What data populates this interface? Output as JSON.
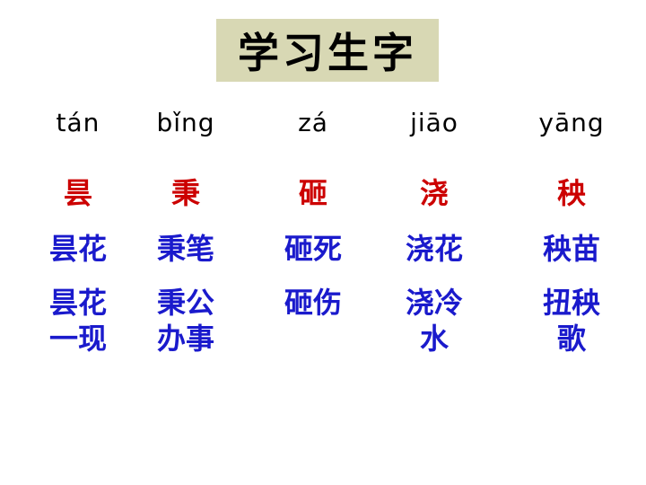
{
  "title": "学习生字",
  "colors": {
    "title_bg": "#d8d8b4",
    "char_color": "#cc0000",
    "word_color": "#1a1acc",
    "pinyin_color": "#000000"
  },
  "columns": [
    {
      "pinyin": "tán",
      "char": "昙",
      "word": "昙花",
      "phrase": "昙花\n一现"
    },
    {
      "pinyin": "bǐng",
      "char": "秉",
      "word": "秉笔",
      "phrase": "秉公\n办事"
    },
    {
      "pinyin": "zá",
      "char": "砸",
      "word": "砸死",
      "phrase": "砸伤"
    },
    {
      "pinyin": "jiāo",
      "char": "浇",
      "word": "浇花",
      "phrase": "浇冷\n水"
    },
    {
      "pinyin": "yāng",
      "char": "秧",
      "word": "秧苗",
      "phrase": "扭秧\n歌"
    }
  ]
}
